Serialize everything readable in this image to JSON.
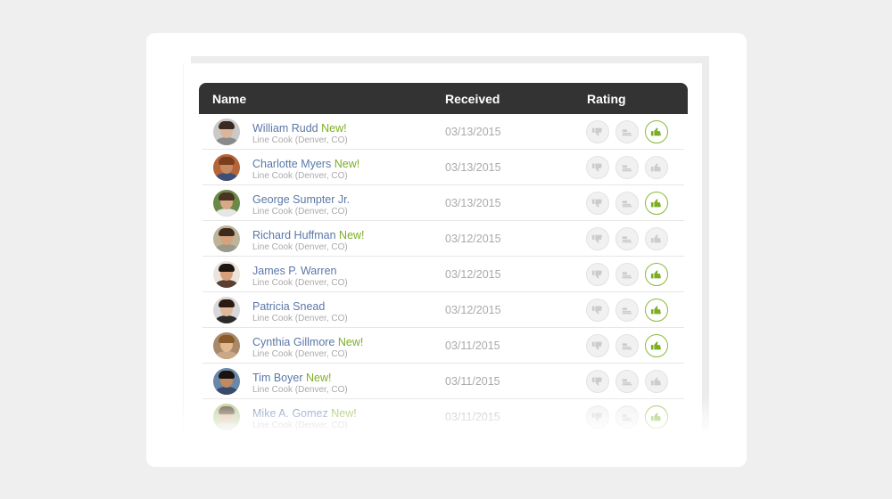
{
  "table": {
    "headers": {
      "name": "Name",
      "received": "Received",
      "rating": "Rating"
    },
    "rows": [
      {
        "name": "William Rudd",
        "new": "New!",
        "role": "Line Cook (Denver, CO)",
        "received": "03/13/2015",
        "rating": "up",
        "avatar_skin": "#d9b59a",
        "avatar_hair": "#3a2a20",
        "avatar_shirt": "#8a8a8a",
        "avatar_bg": "#c9c9c9"
      },
      {
        "name": "Charlotte Myers",
        "new": "New!",
        "role": "Line Cook (Denver, CO)",
        "received": "03/13/2015",
        "rating": "none",
        "avatar_skin": "#c58a62",
        "avatar_hair": "#7a3e1e",
        "avatar_shirt": "#3c4f7a",
        "avatar_bg": "#b5653a"
      },
      {
        "name": "George Sumpter Jr.",
        "new": "",
        "role": "Line Cook (Denver, CO)",
        "received": "03/13/2015",
        "rating": "up",
        "avatar_skin": "#d8a985",
        "avatar_hair": "#4a3320",
        "avatar_shirt": "#e6e6e6",
        "avatar_bg": "#6b8a4a"
      },
      {
        "name": "Richard Huffman",
        "new": "New!",
        "role": "Line Cook (Denver, CO)",
        "received": "03/12/2015",
        "rating": "none",
        "avatar_skin": "#d4a27c",
        "avatar_hair": "#3d2a1c",
        "avatar_shirt": "#9a9a8a",
        "avatar_bg": "#bdb49a"
      },
      {
        "name": "James P. Warren",
        "new": "",
        "role": "Line Cook (Denver, CO)",
        "received": "03/12/2015",
        "rating": "up",
        "avatar_skin": "#d7a07a",
        "avatar_hair": "#1e1510",
        "avatar_shirt": "#5a4030",
        "avatar_bg": "#ebe4dc"
      },
      {
        "name": "Patricia Snead",
        "new": "",
        "role": "Line Cook (Denver, CO)",
        "received": "03/12/2015",
        "rating": "up",
        "avatar_skin": "#e0b89a",
        "avatar_hair": "#2a1a12",
        "avatar_shirt": "#2a2a2a",
        "avatar_bg": "#d8d8d8"
      },
      {
        "name": "Cynthia Gillmore",
        "new": "New!",
        "role": "Line Cook (Denver, CO)",
        "received": "03/11/2015",
        "rating": "up",
        "avatar_skin": "#e4b890",
        "avatar_hair": "#8a5a2a",
        "avatar_shirt": "#c8a888",
        "avatar_bg": "#a88a6a"
      },
      {
        "name": "Tim Boyer",
        "new": "New!",
        "role": "Line Cook (Denver, CO)",
        "received": "03/11/2015",
        "rating": "none",
        "avatar_skin": "#c08a62",
        "avatar_hair": "#1a120c",
        "avatar_shirt": "#3a4a6a",
        "avatar_bg": "#6a88a8"
      },
      {
        "name": "Mike A. Gomez",
        "new": "New!",
        "role": "Line Cook (Denver, CO)",
        "received": "03/11/2015",
        "rating": "up",
        "avatar_skin": "#dcb090",
        "avatar_hair": "#5a4a30",
        "avatar_shirt": "#d0d0c0",
        "avatar_bg": "#b8c890"
      }
    ]
  },
  "rating_icons": [
    "thumbs-down-icon",
    "thumbs-sideways-icon",
    "thumbs-up-icon"
  ],
  "colors": {
    "header_bg": "#333333",
    "name_link": "#5a78a8",
    "new_badge": "#7cae24",
    "selected_rating": "#7cae24"
  }
}
